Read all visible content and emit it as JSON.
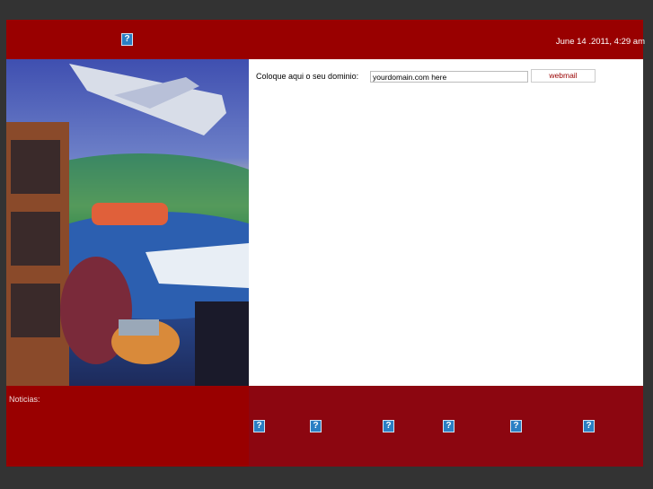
{
  "header": {
    "date": "June 14 .2011, 4:29 am",
    "logo_icon": "broken-image-icon"
  },
  "domain_form": {
    "label": "Coloque aqui o seu dominio:",
    "input_value": "yourdomain.com here",
    "button_label": "webmail"
  },
  "footer": {
    "news_label": "Noticias:",
    "link_icons": [
      "broken-image-icon",
      "broken-image-icon",
      "broken-image-icon",
      "broken-image-icon",
      "broken-image-icon",
      "broken-image-icon"
    ]
  },
  "colors": {
    "header": "#990000",
    "footer_right": "#8c0610",
    "background": "#333333"
  }
}
